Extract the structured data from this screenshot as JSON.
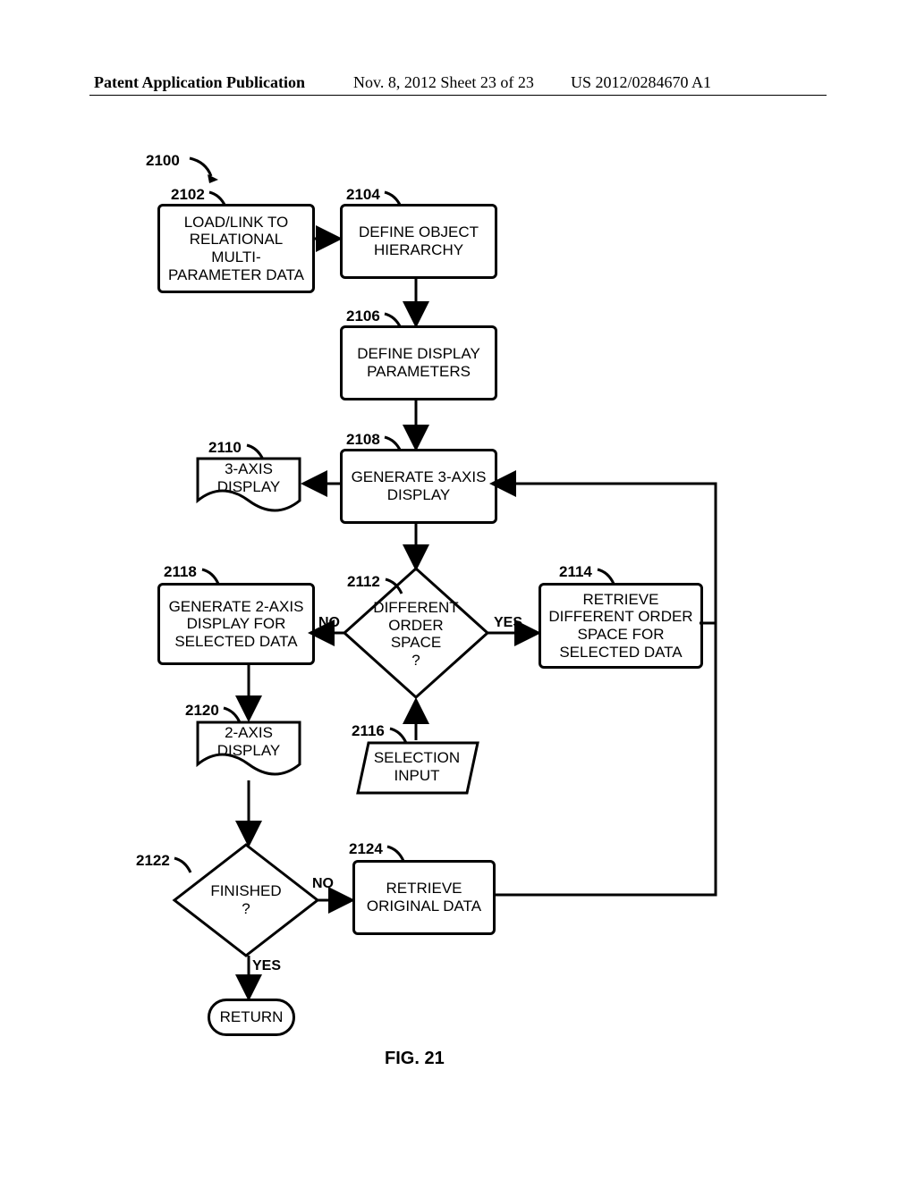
{
  "header": {
    "left": "Patent Application Publication",
    "mid": "Nov. 8, 2012  Sheet 23 of 23",
    "right": "US 2012/0284670 A1"
  },
  "labels": {
    "l2100": "2100",
    "l2102": "2102",
    "l2104": "2104",
    "l2106": "2106",
    "l2108": "2108",
    "l2110": "2110",
    "l2112": "2112",
    "l2114": "2114",
    "l2116": "2116",
    "l2118": "2118",
    "l2120": "2120",
    "l2122": "2122",
    "l2124": "2124"
  },
  "nodes": {
    "n2102": "LOAD/LINK TO\nRELATIONAL\nMULTI-\nPARAMETER DATA",
    "n2104": "DEFINE OBJECT\nHIERARCHY",
    "n2106": "DEFINE DISPLAY\nPARAMETERS",
    "n2108": "GENERATE 3-AXIS\nDISPLAY",
    "n2110": "3-AXIS\nDISPLAY",
    "n2112": "DIFFERENT\nORDER\nSPACE\n?",
    "n2114": "RETRIEVE\nDIFFERENT ORDER\nSPACE FOR\nSELECTED DATA",
    "n2116": "SELECTION\nINPUT",
    "n2118": "GENERATE 2-AXIS\nDISPLAY FOR\nSELECTED DATA",
    "n2120": "2-AXIS\nDISPLAY",
    "n2122": "FINISHED\n?",
    "n2124": "RETRIEVE\nORIGINAL DATA",
    "ret": "RETURN"
  },
  "edges": {
    "no1": "NO",
    "yes1": "YES",
    "no2": "NO",
    "yes2": "YES"
  },
  "figure": "FIG. 21"
}
